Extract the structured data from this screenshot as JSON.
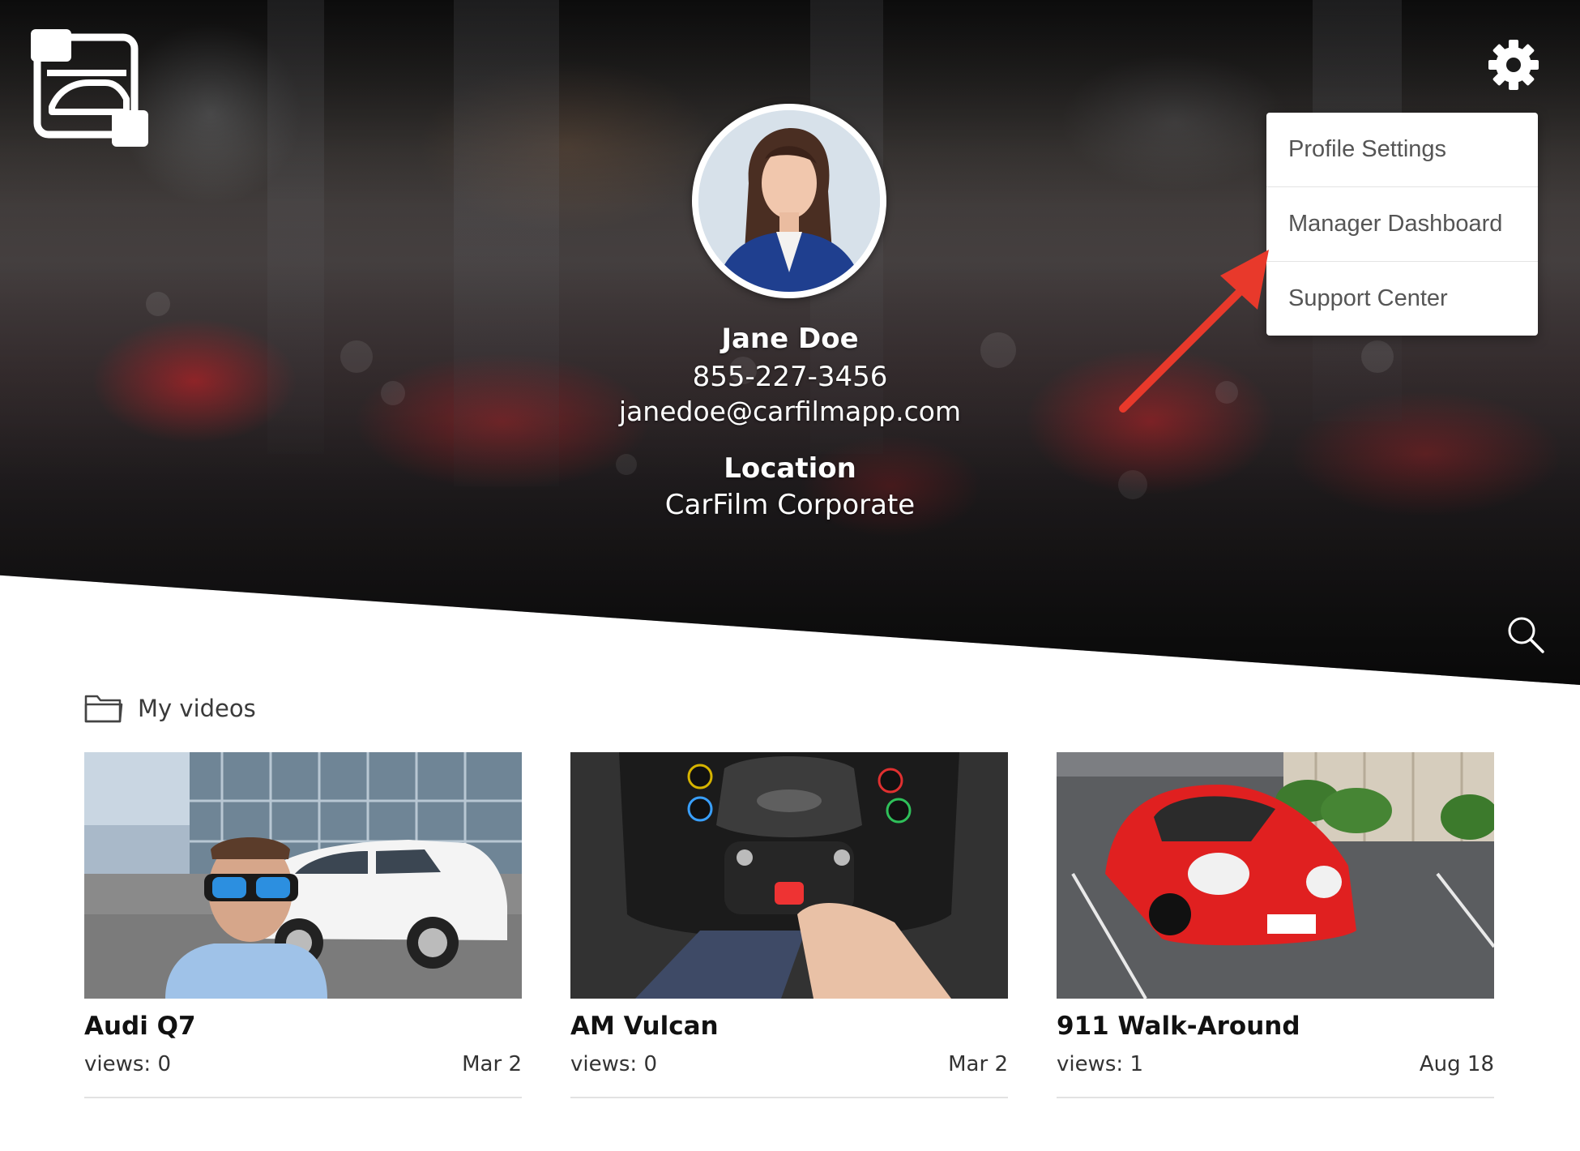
{
  "app": {
    "logo_icon": "carfilm-logo-icon"
  },
  "header": {
    "settings_icon": "gear-icon",
    "search_icon": "search-icon"
  },
  "settings_menu": {
    "items": [
      {
        "label": "Profile Settings"
      },
      {
        "label": "Manager Dashboard"
      },
      {
        "label": "Support Center"
      }
    ],
    "annotation_color": "#e8392b"
  },
  "profile": {
    "name": "Jane Doe",
    "phone": "855-227-3456",
    "email": "janedoe@carfilmapp.com",
    "location_label": "Location",
    "location": "CarFilm Corporate"
  },
  "videos": {
    "section_icon": "folder-icon",
    "section_title": "My videos",
    "items": [
      {
        "title": "Audi Q7",
        "views": "views: 0",
        "date": "Mar 2",
        "thumb_icon": "audi-q7-thumbnail"
      },
      {
        "title": "AM Vulcan",
        "views": "views: 0",
        "date": "Mar 2",
        "thumb_icon": "am-vulcan-thumbnail"
      },
      {
        "title": "911 Walk-Around",
        "views": "views: 1",
        "date": "Aug 18",
        "thumb_icon": "911-walkaround-thumbnail"
      }
    ]
  },
  "colors": {
    "accent_red": "#e8392b",
    "text_dark": "#111111",
    "menu_text": "#555555"
  }
}
